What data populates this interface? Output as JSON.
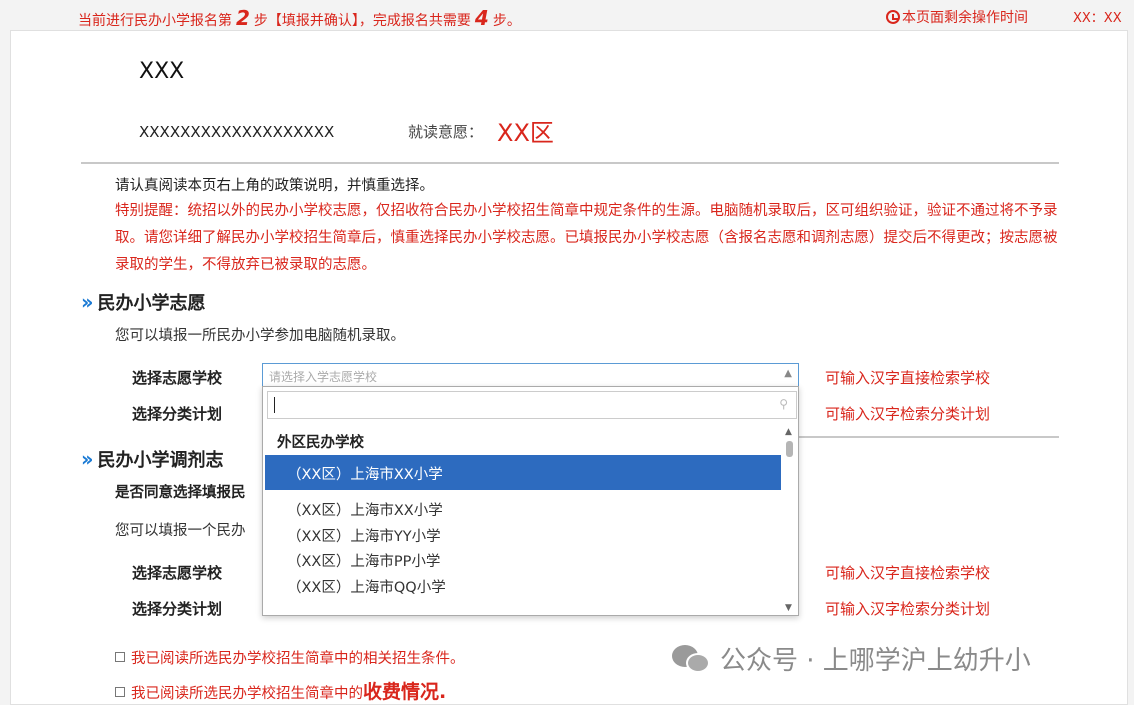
{
  "topbar": {
    "step_prefix": "当前进行民办小学报名第",
    "step_num": "2",
    "step_mid": "步【填报并确认】，完成报名共需要",
    "total_num": "4",
    "step_suffix": "步。",
    "timer_label": "本页面剩余操作时间",
    "timer_value": "XX：XX"
  },
  "applicant": {
    "name": "XXX",
    "id_number": "XXXXXXXXXXXXXXXXXXX",
    "wish_label": "就读意愿：",
    "wish_value": "XX区"
  },
  "notice": {
    "line1": "请认真阅读本页右上角的政策说明，并慎重选择。",
    "line2": "特别提醒：统招以外的民办小学校志愿，仅招收符合民办小学校招生简章中规定条件的生源。电脑随机录取后，区可组织验证，验证不通过将不予录取。请您详细了解民办小学校招生简章后，慎重选择民办小学校志愿。已填报民办小学校志愿（含报名志愿和调剂志愿）提交后不得更改；按志愿被录取的学生，不得放弃已被录取的志愿。"
  },
  "section1": {
    "title": "民办小学志愿",
    "subtitle": "您可以填报一所民办小学参加电脑随机录取。",
    "school_label": "选择志愿学校",
    "school_placeholder": "请选择入学志愿学校",
    "school_hint": "可输入汉字直接检索学校",
    "plan_label": "选择分类计划",
    "plan_hint": "可输入汉字检索分类计划"
  },
  "section2": {
    "title": "民办小学调剂志",
    "agree_question": "是否同意选择填报民",
    "subtitle": "您可以填报一个民办",
    "school_label": "选择志愿学校",
    "school_hint": "可输入汉字直接检索学校",
    "plan_label": "选择分类计划",
    "plan_hint": "可输入汉字检索分类计划"
  },
  "dropdown": {
    "group": "外区民办学校",
    "selected": "（XX区）上海市XX小学",
    "items": [
      "（XX区）上海市XX小学",
      "（XX区）上海市YY小学",
      "（XX区）上海市PP小学",
      "（XX区）上海市QQ小学"
    ]
  },
  "checks": {
    "check1": "我已阅读所选民办学校招生简章中的相关招生条件。",
    "check2_prefix": "我已阅读所选民办学校招生简章中的",
    "check2_emph": "收费情况."
  },
  "watermark": "公众号 · 上哪学沪上幼升小",
  "colors": {
    "accent_red": "#d9261c",
    "selected_blue": "#2d6bbf",
    "arrow_blue": "#1a7ad4"
  }
}
